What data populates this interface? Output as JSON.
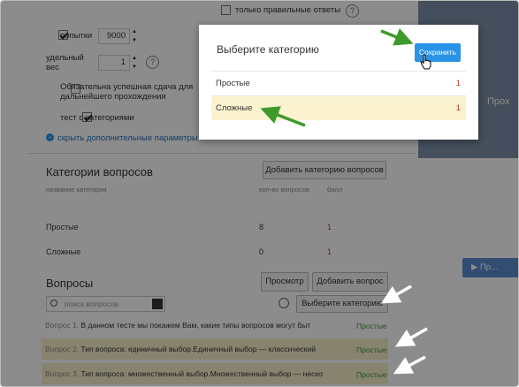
{
  "settings": {
    "only_correct_label": "только правильные ответы",
    "attempts_label": "попытки",
    "attempts_value": "9000",
    "weight_label": "удельный вес",
    "weight_value": "1",
    "mandatory_label": "Обязательна успешная сдача для дальнейшего прохождения",
    "categories_test_label": "тест с категориями",
    "hide_params_link": "скрыть дополнительные параметры",
    "help_glyph": "?"
  },
  "categories_section": {
    "title": "Категории вопросов",
    "add_button": "Добавить категорию вопросов",
    "col_name": "название категории",
    "col_count": "кол-во вопросов",
    "col_points": "балл",
    "rows": [
      {
        "name": "Простые",
        "count": "8",
        "points": "1"
      },
      {
        "name": "Сложные",
        "count": "0",
        "points": "1"
      }
    ]
  },
  "questions_section": {
    "title": "Вопросы",
    "preview_button": "Просмотр",
    "add_button": "Добавить вопрос",
    "search_placeholder": "поиск вопросов",
    "select_category_button": "Выберите категорию",
    "rows": [
      {
        "num": "Вопрос 1.",
        "text": "В данном тесте мы покажем Вам, какие типы вопросов могут быт",
        "category": "Простые"
      },
      {
        "num": "Вопрос 2.",
        "text": "Тип вопроса: единичный выбор.Единичный выбор — классический",
        "category": "Простые"
      },
      {
        "num": "Вопрос 3.",
        "text": "Тип вопроса: множественный выбор.Множественный выбор — неско",
        "category": "Простые"
      }
    ]
  },
  "right_panel": {
    "partial_text": "Прох",
    "button_text": "▶ Пр..."
  },
  "modal": {
    "title": "Выберите категорию",
    "save_button": "Сохранить",
    "rows": [
      {
        "name": "Простые",
        "count": "1"
      },
      {
        "name": "Сложные",
        "count": "1"
      }
    ]
  },
  "colors": {
    "accent": "#2b93e6",
    "annotation_arrow": "#3f9a2c",
    "selected_row": "#fbf3cf",
    "count_red": "#c0392b",
    "category_green": "#3a9a3a"
  }
}
